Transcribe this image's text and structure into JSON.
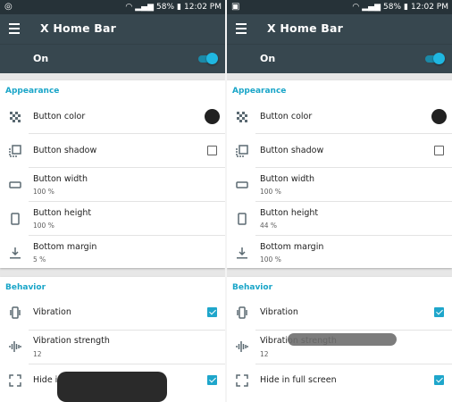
{
  "status_bar": {
    "battery": "58%",
    "time": "12:02 PM"
  },
  "app_title": "X Home Bar",
  "master_switch": {
    "label": "On",
    "checked": true
  },
  "accent_color": "#1fb7e1",
  "toolbar_color": "#37474f",
  "panels": [
    {
      "appearance": {
        "title": "Appearance",
        "button_color": {
          "label": "Button color",
          "color": "#212121"
        },
        "button_shadow": {
          "label": "Button shadow",
          "checked": false
        },
        "button_width": {
          "label": "Button width",
          "value": "100 %"
        },
        "button_height": {
          "label": "Button height",
          "value": "100 %"
        },
        "bottom_margin": {
          "label": "Bottom margin",
          "value": "5 %"
        }
      },
      "behavior": {
        "title": "Behavior",
        "vibration": {
          "label": "Vibration",
          "checked": true
        },
        "vibration_strength": {
          "label": "Vibration strength",
          "value": "12"
        },
        "hide_fullscreen": {
          "label": "Hide in full screen",
          "visible_label": "Hide in",
          "checked": true
        }
      }
    },
    {
      "appearance": {
        "title": "Appearance",
        "button_color": {
          "label": "Button color",
          "color": "#212121"
        },
        "button_shadow": {
          "label": "Button shadow",
          "checked": false
        },
        "button_width": {
          "label": "Button width",
          "value": "100 %"
        },
        "button_height": {
          "label": "Button height",
          "value": "44 %"
        },
        "bottom_margin": {
          "label": "Bottom margin",
          "value": "100 %"
        }
      },
      "behavior": {
        "title": "Behavior",
        "vibration": {
          "label": "Vibration",
          "checked": true
        },
        "vibration_strength": {
          "label": "Vibration strength",
          "value": "12"
        },
        "hide_fullscreen": {
          "label": "Hide in full screen",
          "checked": true
        }
      }
    }
  ]
}
